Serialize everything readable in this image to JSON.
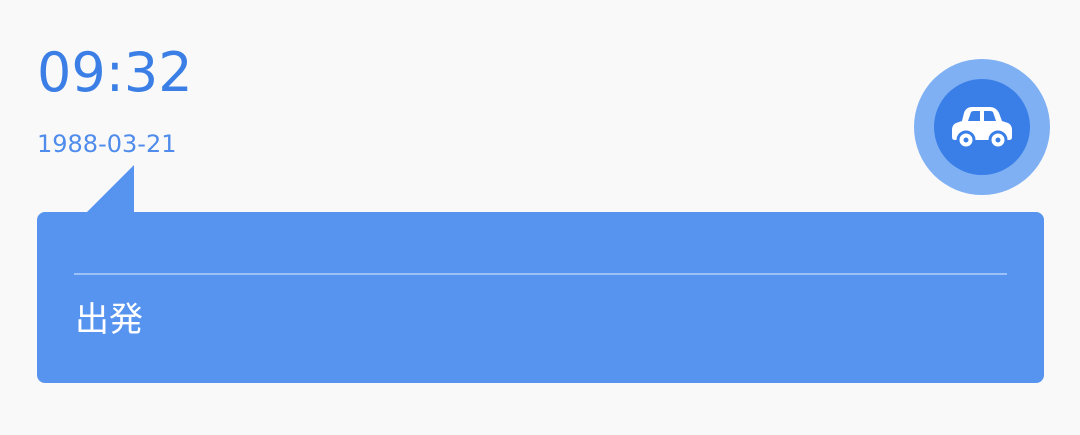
{
  "time": "09:32",
  "date": "1988-03-21",
  "transport": {
    "icon": "car-icon"
  },
  "card": {
    "label": "出発"
  },
  "colors": {
    "background": "#f9f9f9",
    "accent": "#3b7fe6",
    "card": "#5794ef",
    "badge_outer": "#7eb0f3",
    "badge_inner": "#3a7fe8"
  }
}
